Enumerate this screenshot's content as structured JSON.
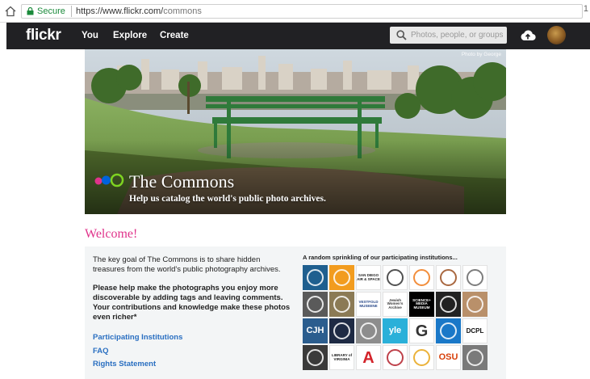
{
  "browser": {
    "secure_label": "Secure",
    "url_host": "https://www.flickr.com/",
    "url_path": "commons",
    "overflow_number": "1"
  },
  "navbar": {
    "logo": "flickr",
    "links": [
      "You",
      "Explore",
      "Create"
    ],
    "search_placeholder": "Photos, people, or groups"
  },
  "hero": {
    "photo_credit": "Photo by George",
    "title": "The Commons",
    "subtitle": "Help us catalog the world's public photo archives."
  },
  "welcome": "Welcome!",
  "panel": {
    "intro": "The key goal of The Commons is to share hidden treasures from the world's public photography archives.",
    "bold_paragraph": "Please help make the photographs you enjoy more discoverable by adding tags and leaving comments. Your contributions and knowledge make these photos even richer*",
    "links": [
      "Participating Institutions",
      "FAQ",
      "Rights Statement"
    ],
    "institutions_heading": "A random sprinkling of our participating institutions...",
    "tiles": [
      {
        "name": "tile-star-logo",
        "label": "",
        "bg": "#1f5f8f",
        "fg": "#ffffff"
      },
      {
        "name": "tile-orange-seal",
        "label": "",
        "bg": "#f29c1f",
        "fg": "#ffffff"
      },
      {
        "name": "tile-san-diego-air",
        "label": "SAN DIEGO AIR & SPACE",
        "bg": "#ffffff",
        "fg": "#222222"
      },
      {
        "name": "tile-state-library",
        "label": "",
        "bg": "#ffffff",
        "fg": "#333333"
      },
      {
        "name": "tile-orange-flower",
        "label": "",
        "bg": "#ffffff",
        "fg": "#f07a1a"
      },
      {
        "name": "tile-round-seal",
        "label": "",
        "bg": "#ffffff",
        "fg": "#9a4d1f"
      },
      {
        "name": "tile-building-sketch",
        "label": "",
        "bg": "#ffffff",
        "fg": "#666666"
      },
      {
        "name": "tile-old-photo-1",
        "label": "",
        "bg": "#5a5a5a",
        "fg": "#ffffff"
      },
      {
        "name": "tile-old-photo-2",
        "label": "",
        "bg": "#8b7a55",
        "fg": "#ffffff"
      },
      {
        "name": "tile-vestfold",
        "label": "VESTFOLD MUSEENE",
        "bg": "#ffffff",
        "fg": "#2a4a8a"
      },
      {
        "name": "tile-jewish-womens-archive",
        "label": "Jewish Women's Archive",
        "bg": "#ffffff",
        "fg": "#333333"
      },
      {
        "name": "tile-science-media-museum",
        "label": "SCIENCE+ MEDIA MUSEUM",
        "bg": "#000000",
        "fg": "#ffffff"
      },
      {
        "name": "tile-dark-stripes",
        "label": "",
        "bg": "#222222",
        "fg": "#ffffff"
      },
      {
        "name": "tile-sepia-portrait",
        "label": "",
        "bg": "#b9906a",
        "fg": "#ffffff"
      },
      {
        "name": "tile-cjh",
        "label": "CJH",
        "bg": "#2b5d8e",
        "fg": "#ffffff"
      },
      {
        "name": "tile-dark-photo",
        "label": "",
        "bg": "#1e2a44",
        "fg": "#ffffff"
      },
      {
        "name": "tile-building-photo",
        "label": "",
        "bg": "#8d8d8d",
        "fg": "#ffffff"
      },
      {
        "name": "tile-yle",
        "label": "yle",
        "bg": "#2ab0d9",
        "fg": "#ffffff"
      },
      {
        "name": "tile-g-logo",
        "label": "G",
        "bg": "#ffffff",
        "fg": "#333333"
      },
      {
        "name": "tile-blue-grid",
        "label": "",
        "bg": "#1a78c8",
        "fg": "#ffffff"
      },
      {
        "name": "tile-dcpl",
        "label": "DCPL",
        "bg": "#ffffff",
        "fg": "#111111"
      },
      {
        "name": "tile-tower-photo",
        "label": "",
        "bg": "#3a3a3a",
        "fg": "#ffffff"
      },
      {
        "name": "tile-library-virginia",
        "label": "LIBRARY of VIRGINIA",
        "bg": "#ffffff",
        "fg": "#222222"
      },
      {
        "name": "tile-red-a",
        "label": "A",
        "bg": "#ffffff",
        "fg": "#d3232a"
      },
      {
        "name": "tile-red-seal",
        "label": "",
        "bg": "#ffffff",
        "fg": "#b3202a"
      },
      {
        "name": "tile-sunflower",
        "label": "",
        "bg": "#ffffff",
        "fg": "#e8a418"
      },
      {
        "name": "tile-osu",
        "label": "OSU",
        "bg": "#ffffff",
        "fg": "#d73f09"
      },
      {
        "name": "tile-street-photo",
        "label": "",
        "bg": "#7a7a7a",
        "fg": "#ffffff"
      }
    ]
  }
}
